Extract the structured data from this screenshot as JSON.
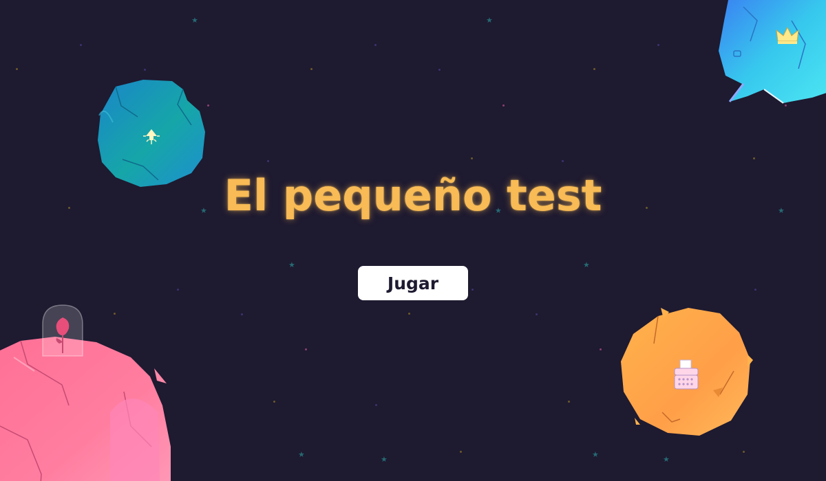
{
  "title": "El pequeño test",
  "play_button": {
    "label": "Jugar"
  },
  "planets": [
    {
      "name": "teal-planet",
      "icon": "lamplighter-lamp-icon",
      "color": "#1aa7b5"
    },
    {
      "name": "cyan-planet",
      "icon": "crown-icon",
      "color": "#3ad6f0"
    },
    {
      "name": "pink-planet",
      "icon": "rose-under-glass-icon",
      "color": "#ff7aa3"
    },
    {
      "name": "orange-planet",
      "icon": "typewriter-icon",
      "color": "#ffad50"
    }
  ],
  "colors": {
    "background": "#1e1a30",
    "title": "#f8bb55",
    "button_bg": "#ffffff",
    "button_text": "#1e1a30"
  }
}
